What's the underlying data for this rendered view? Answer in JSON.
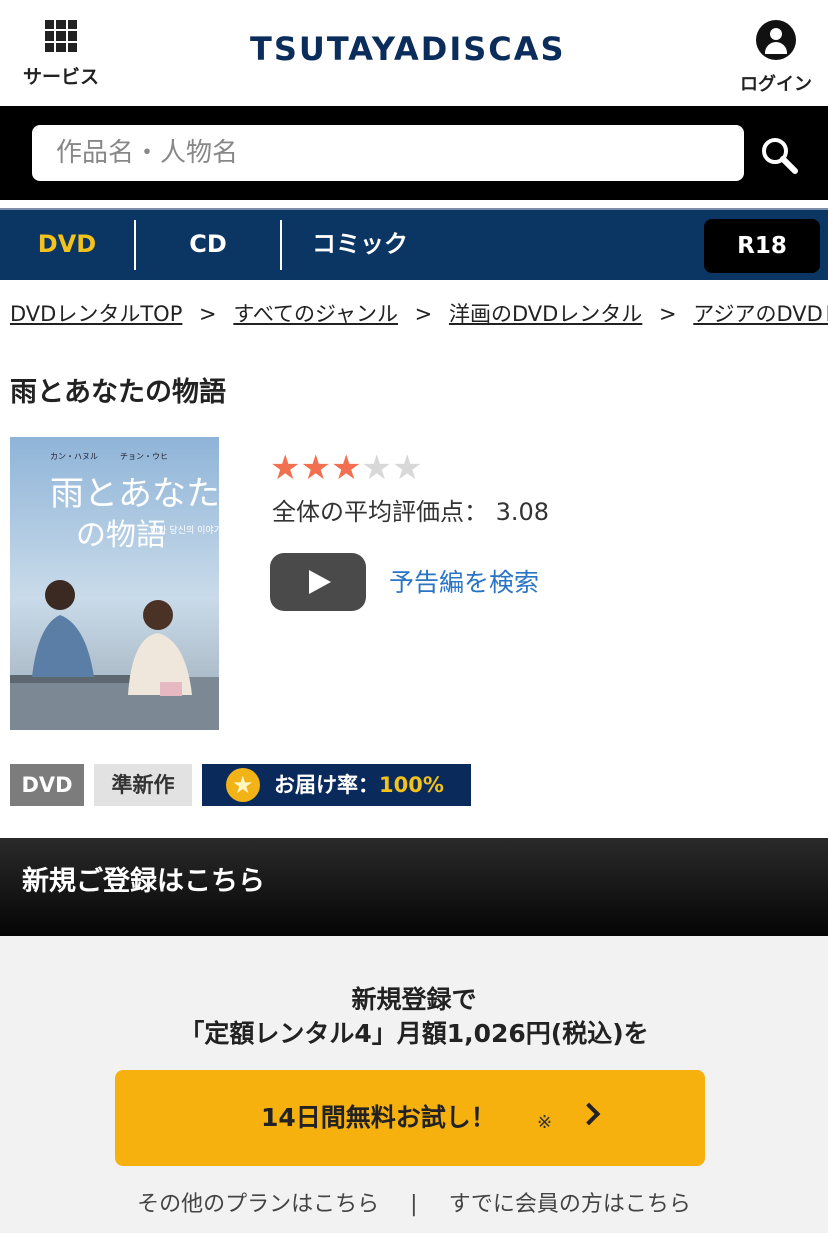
{
  "header": {
    "service_label": "サービス",
    "logo": "TSUTAYADISCAS",
    "login_label": "ログイン"
  },
  "search": {
    "placeholder": "作品名・人物名",
    "value": ""
  },
  "nav": {
    "tabs": [
      {
        "label": "DVD",
        "active": true
      },
      {
        "label": "CD",
        "active": false
      },
      {
        "label": "コミック",
        "active": false
      }
    ],
    "r18_label": "R18"
  },
  "breadcrumb": [
    "DVDレンタルTOP",
    "すべてのジャンル",
    "洋画のDVDレンタル",
    "アジアのDVDレンタル"
  ],
  "breadcrumb_sep": ">",
  "title": "雨とあなたの物語",
  "poster": {
    "title_line1": "雨とあなた",
    "title_line2": "の物語",
    "cast_left": "カン・ハヌル",
    "cast_right": "チョン・ウヒ",
    "korean_title": "비와 당신의 이야기"
  },
  "rating": {
    "stars": 3,
    "max": 5,
    "avg_label": "全体の平均評価点：",
    "avg_value": "3.08"
  },
  "trailer_label": "予告編を検索",
  "badges": {
    "format": "DVD",
    "release": "準新作",
    "delivery_label": "お届け率：",
    "delivery_value": "100%"
  },
  "registration": {
    "heading": "新規ご登録はこちら",
    "line1": "新規登録で",
    "line2": "「定額レンタル4」月額1,026円(税込)を",
    "cta_label": "14日間無料お試し！",
    "cta_note": "※",
    "other_plans": "その他のプランはこちら",
    "divider": "|",
    "members": "すでに会員の方はこちら"
  },
  "colors": {
    "nav_bg": "#0b3563",
    "active_tab": "#f3c21b",
    "cta": "#f6b10f",
    "link": "#2a74c5",
    "star_on": "#f07050"
  }
}
